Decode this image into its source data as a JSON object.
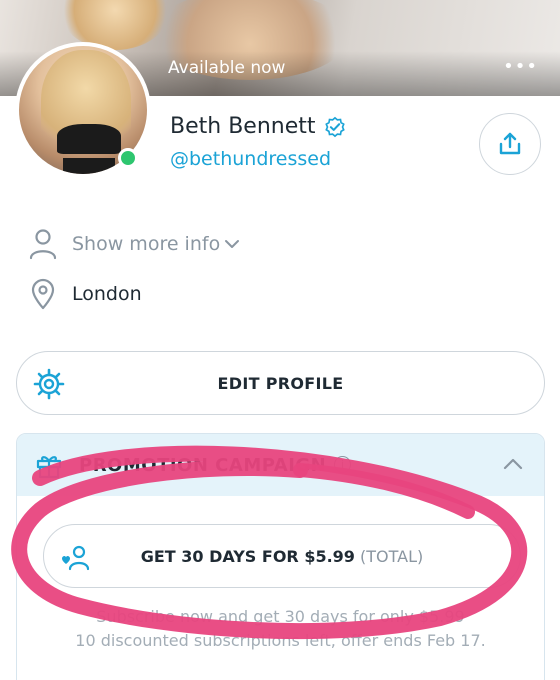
{
  "cover": {
    "status_text": "Available now",
    "more_glyph": "•••"
  },
  "profile": {
    "name": "Beth Bennett",
    "handle": "@bethundressed",
    "verified": true,
    "online": true
  },
  "info": {
    "show_more": "Show more info",
    "location": "London"
  },
  "edit_profile": {
    "label": "EDIT PROFILE"
  },
  "promotion": {
    "title": "PROMOTION CAMPAIGN",
    "deal_main": "GET 30 DAYS FOR $5.99",
    "deal_suffix": "(TOTAL)",
    "note_line1": "Subscribe now and get 30 days for only $5.99",
    "note_line2": "10 discounted subscriptions left, offer ends Feb 17."
  },
  "icons": [
    "ellipsis-icon",
    "verified-icon",
    "share-icon",
    "user-icon",
    "chevron-down-icon",
    "location-pin-icon",
    "gear-icon",
    "gift-icon",
    "info-icon",
    "chevron-up-icon",
    "subscribe-heart-user-icon"
  ],
  "colors": {
    "accent": "#1ba3d6",
    "online": "#2ec66f",
    "promo_header_bg": "#e4f3fa",
    "annotation_stroke": "#e8457e"
  }
}
